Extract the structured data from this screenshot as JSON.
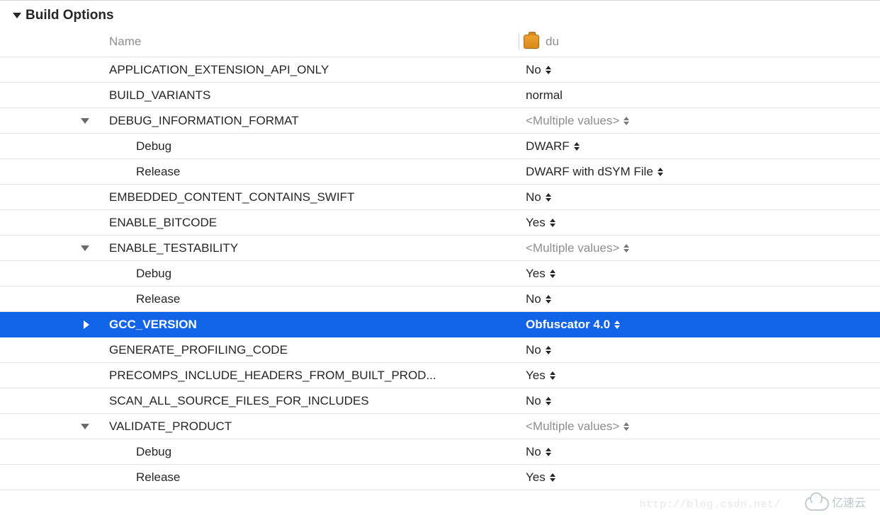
{
  "section_title": "Build Options",
  "columns": {
    "name": "Name",
    "target": "du"
  },
  "rows": [
    {
      "id": "app-ext",
      "name": "APPLICATION_EXTENSION_API_ONLY",
      "value": "No",
      "stepper": true
    },
    {
      "id": "build-variants",
      "name": "BUILD_VARIANTS",
      "value": "normal",
      "stepper": false
    },
    {
      "id": "debug-info",
      "name": "DEBUG_INFORMATION_FORMAT",
      "value": "<Multiple values>",
      "stepper": true,
      "expandable": true,
      "muted": true
    },
    {
      "id": "debug-info-debug",
      "name": "Debug",
      "value": "DWARF",
      "stepper": true,
      "indent": true
    },
    {
      "id": "debug-info-release",
      "name": "Release",
      "value": "DWARF with dSYM File",
      "stepper": true,
      "indent": true
    },
    {
      "id": "embedded-swift",
      "name": "EMBEDDED_CONTENT_CONTAINS_SWIFT",
      "value": "No",
      "stepper": true
    },
    {
      "id": "enable-bitcode",
      "name": "ENABLE_BITCODE",
      "value": "Yes",
      "stepper": true
    },
    {
      "id": "enable-testability",
      "name": "ENABLE_TESTABILITY",
      "value": "<Multiple values>",
      "stepper": true,
      "expandable": true,
      "muted": true
    },
    {
      "id": "enable-testability-debug",
      "name": "Debug",
      "value": "Yes",
      "stepper": true,
      "indent": true
    },
    {
      "id": "enable-testability-release",
      "name": "Release",
      "value": "No",
      "stepper": true,
      "indent": true
    },
    {
      "id": "gcc-version",
      "name": "GCC_VERSION",
      "value": "Obfuscator 4.0",
      "stepper": true,
      "collapsed": true,
      "selected": true
    },
    {
      "id": "gen-profiling",
      "name": "GENERATE_PROFILING_CODE",
      "value": "No",
      "stepper": true
    },
    {
      "id": "precomps",
      "name": "PRECOMPS_INCLUDE_HEADERS_FROM_BUILT_PROD...",
      "value": "Yes",
      "stepper": true
    },
    {
      "id": "scan-all",
      "name": "SCAN_ALL_SOURCE_FILES_FOR_INCLUDES",
      "value": "No",
      "stepper": true
    },
    {
      "id": "validate-product",
      "name": "VALIDATE_PRODUCT",
      "value": "<Multiple values>",
      "stepper": true,
      "expandable": true,
      "muted": true
    },
    {
      "id": "validate-product-debug",
      "name": "Debug",
      "value": "No",
      "stepper": true,
      "indent": true
    },
    {
      "id": "validate-product-release",
      "name": "Release",
      "value": "Yes",
      "stepper": true,
      "indent": true
    }
  ],
  "watermark": "亿速云",
  "ghost_url": "http://blog.csdn.net/"
}
